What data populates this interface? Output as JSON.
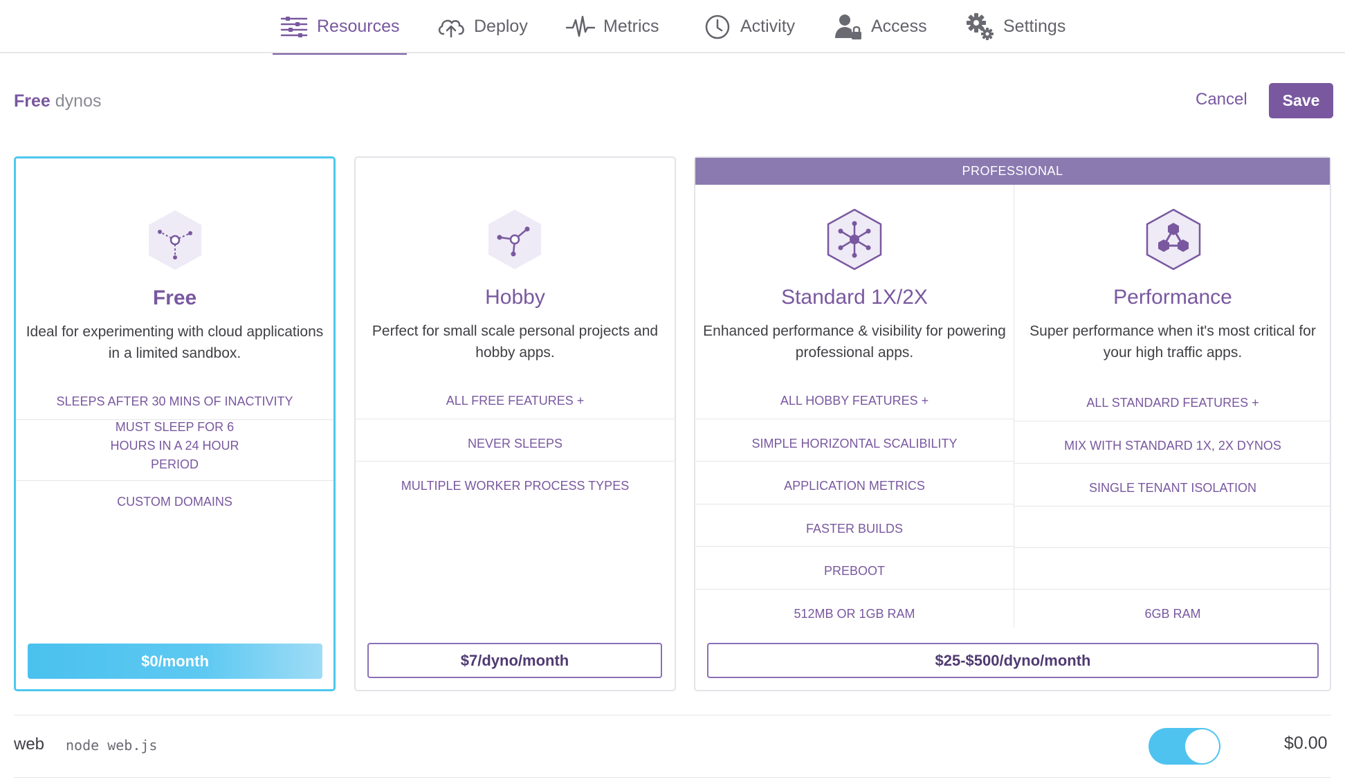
{
  "nav": {
    "tabs": [
      {
        "label": "Resources",
        "icon": "resources-icon",
        "active": true
      },
      {
        "label": "Deploy",
        "icon": "cloud-upload-icon",
        "active": false
      },
      {
        "label": "Metrics",
        "icon": "pulse-icon",
        "active": false
      },
      {
        "label": "Activity",
        "icon": "clock-icon",
        "active": false
      },
      {
        "label": "Access",
        "icon": "user-lock-icon",
        "active": false
      },
      {
        "label": "Settings",
        "icon": "gears-icon",
        "active": false
      }
    ]
  },
  "header": {
    "title_strong": "Free",
    "title_light": "dynos",
    "cancel_label": "Cancel",
    "save_label": "Save"
  },
  "plans": {
    "free": {
      "name": "Free",
      "description": "Ideal for experimenting with cloud applications in a limited sandbox.",
      "features": [
        "SLEEPS AFTER 30 MINS OF INACTIVITY",
        "MUST SLEEP FOR 6 HOURS IN A 24 HOUR PERIOD",
        "CUSTOM DOMAINS"
      ],
      "price": "$0/month",
      "icon": "free-dyno-icon"
    },
    "hobby": {
      "name": "Hobby",
      "description": "Perfect for small scale personal projects and hobby apps.",
      "features": [
        "ALL FREE FEATURES +",
        "NEVER SLEEPS",
        "MULTIPLE WORKER PROCESS TYPES"
      ],
      "price": "$7/dyno/month",
      "icon": "hobby-dyno-icon"
    },
    "professional": {
      "header": "PROFESSIONAL",
      "price": "$25-$500/dyno/month",
      "standard": {
        "name": "Standard 1X/2X",
        "description": "Enhanced performance & visibility for powering professional apps.",
        "features": [
          "ALL HOBBY FEATURES +",
          "SIMPLE HORIZONTAL SCALIBILITY",
          "APPLICATION METRICS",
          "FASTER BUILDS",
          "PREBOOT",
          "512MB OR 1GB RAM"
        ],
        "icon": "standard-dyno-icon"
      },
      "performance": {
        "name": "Performance",
        "description": "Super performance when it's most critical for your high traffic apps.",
        "features": [
          "ALL STANDARD FEATURES +",
          "MIX WITH STANDARD 1X, 2X DYNOS",
          "SINGLE TENANT ISOLATION",
          "6GB RAM"
        ],
        "icon": "performance-dyno-icon"
      }
    }
  },
  "process": {
    "name": "web",
    "command": "node web.js",
    "enabled": true,
    "cost": "$0.00"
  },
  "colors": {
    "brand": "#79589f",
    "selected_border": "#4dc7ee",
    "toggle_on": "#4fc3ef",
    "pro_header": "#8b7ab0"
  }
}
